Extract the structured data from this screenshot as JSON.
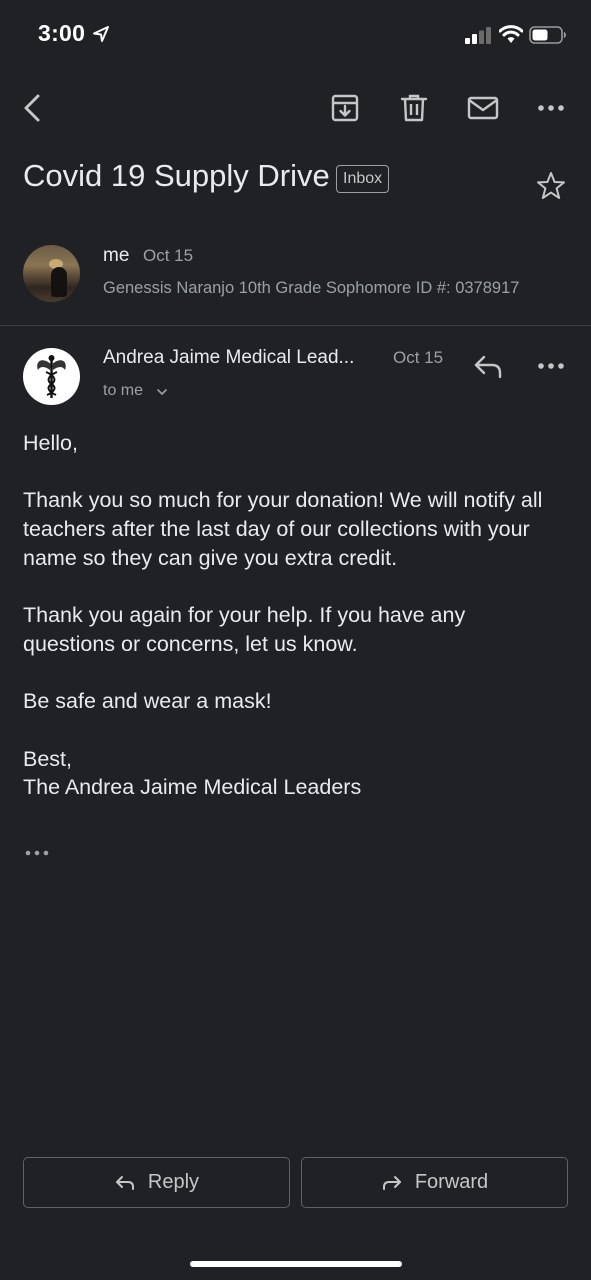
{
  "status_bar": {
    "time": "3:00"
  },
  "email": {
    "subject": "Covid 19 Supply Drive",
    "label": "Inbox"
  },
  "messages": [
    {
      "sender": "me",
      "date": "Oct 15",
      "snippet": "Genessis Naranjo 10th Grade Sophomore ID #: 0378917"
    },
    {
      "sender": "Andrea Jaime Medical Lead...",
      "date": "Oct 15",
      "recipient": "to me",
      "body": [
        "Hello,",
        "Thank you so much for your donation! We will notify all teachers after the last day of our collections with your name so they can give you extra credit.",
        "Thank you again for your help. If you have any questions or concerns, let us know.",
        "Be safe and wear a mask!"
      ],
      "signoff": "Best,",
      "signature": "The Andrea Jaime Medical Leaders"
    }
  ],
  "actions": {
    "reply_label": "Reply",
    "forward_label": "Forward"
  },
  "icons": [
    "back-icon",
    "archive-icon",
    "trash-icon",
    "mail-icon",
    "more-icon",
    "star-icon",
    "reply-icon",
    "forward-icon"
  ],
  "colors": {
    "background": "#202124",
    "text": "#e8eaed",
    "secondary": "#9aa0a6",
    "border": "#5f6368"
  }
}
